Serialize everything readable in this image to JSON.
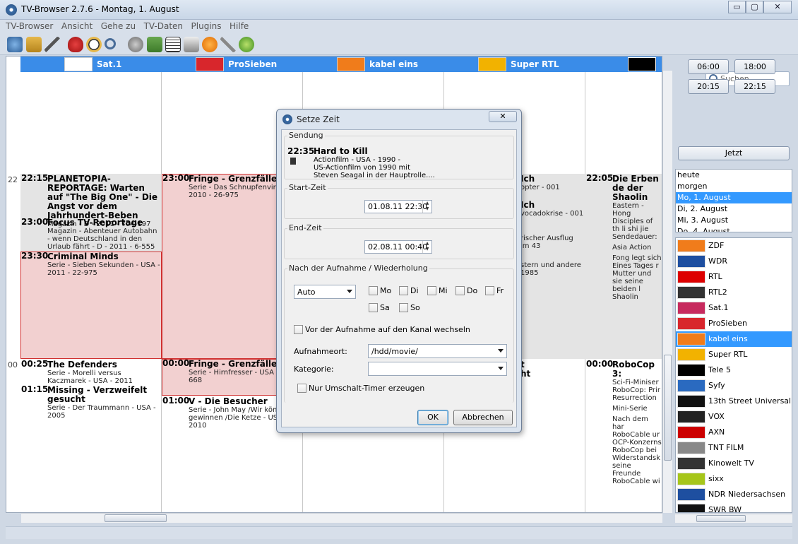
{
  "window": {
    "title": "TV-Browser 2.7.6 - Montag, 1. August",
    "min": "▭",
    "max": "▢",
    "close": "✕"
  },
  "menu": [
    "TV-Browser",
    "Ansicht",
    "Gehe zu",
    "TV-Daten",
    "Plugins",
    "Hilfe"
  ],
  "toolbar": {
    "icons": [
      "globe-update-icon",
      "tree-icon",
      "filter-icon",
      "heart-icon",
      "clock-icon",
      "search-icon",
      "film-icon",
      "copy-icon",
      "list-icon",
      "print-icon",
      "warning-icon",
      "clip-icon",
      "globe-icon"
    ],
    "search_placeholder": "Suchen..."
  },
  "channels_header": [
    {
      "name": "Sat.1",
      "color": "#c72a5e"
    },
    {
      "name": "ProSieben",
      "color": "#d8262c"
    },
    {
      "name": "kabel eins",
      "color": "#f07c1b"
    },
    {
      "name": "Super RTL",
      "color": "#f2b200"
    },
    {
      "name": "",
      "color": "#000000"
    }
  ],
  "hours": [
    "22",
    "00"
  ],
  "programs": {
    "sat1_2215": {
      "time": "22:15",
      "title": "PLANETOPIA-REPORTAGE: Warten auf \"The Big One\" - Die Angst vor dem Jahrhundert-Beben",
      "desc": "Magazin - D - 2011 - 704-197"
    },
    "sat1_2300": {
      "time": "23:00",
      "title": "Focus TV-Reportage",
      "desc": "Magazin - Abenteuer Autobahn - wenn Deutschland in den Urlaub fährt - D - 2011 - 6-555"
    },
    "sat1_2330": {
      "time": "23:30",
      "title": "Criminal Minds",
      "desc": "Serie - Sieben Sekunden - USA - 2011 - 22-975"
    },
    "sat1_0025": {
      "time": "00:25",
      "title": "The Defenders",
      "desc": "Serie - Morelli versus Kaczmarek - USA - 2011"
    },
    "sat1_0115": {
      "time": "01:15",
      "title": "Missing - Verzweifelt gesucht",
      "desc": "Serie - Der Traummann - USA - 2005"
    },
    "pro7_2300": {
      "time": "23:00",
      "title": "Fringe - Grenzfälle des",
      "desc": "Serie - Das Schnupfenvirus - 2010 - 26-975"
    },
    "pro7_0000": {
      "time": "00:00",
      "title": "Fringe - Grenzfälle des",
      "desc": "Serie - Hirnfresser - USA - 2 11-668"
    },
    "pro7_0100": {
      "time": "01:00",
      "title": "V - Die Besucher",
      "desc": "Serie - John May /Wir könn nicht gewinnen /Die Ketze - USA - 2010"
    },
    "srtl_a": {
      "title": "Ich",
      "desc": "opter - 001"
    },
    "srtl_b": {
      "title": "Ich",
      "desc": "vocadokrise - 001"
    },
    "srtl_c": {
      "desc": "rischer Ausflug im 43"
    },
    "srtl_d": {
      "desc": "stern und andere 1985"
    },
    "srtl_e": {
      "title": "t"
    },
    "srtl_f": {
      "title": "ht"
    },
    "tele5_2205": {
      "time": "22:05",
      "title": "Die Erben de der Shaolin",
      "desc": "Eastern - Hong Disciples of th li shi jie Sendedauer:",
      "extra": "Asia Action",
      "extra2": "Fong legt sich Eines Tages r Mutter und sie seine beiden l Shaolin"
    },
    "tele5_0000": {
      "time": "00:00",
      "title": "RoboCop 3:",
      "desc": "Sci-Fi-Miniser RoboCop: Prir Resurrection",
      "extra": "Mini-Serie",
      "extra2": "Nach dem har RoboCable ur OCP-Konzerns RoboCop bei Widerstandsk seine Freunde RoboCable wi"
    }
  },
  "right": {
    "times": [
      "06:00",
      "18:00",
      "20:15",
      "22:15"
    ],
    "jetzt": "Jetzt",
    "days": [
      "heute",
      "morgen",
      "Mo, 1. August",
      "Di, 2. August",
      "Mi, 3. August",
      "Do, 4. August"
    ],
    "channels": [
      "ZDF",
      "WDR",
      "RTL",
      "RTL2",
      "Sat.1",
      "ProSieben",
      "kabel eins",
      "Super RTL",
      "Tele 5",
      "Syfy",
      "13th Street Universal",
      "VOX",
      "AXN",
      "TNT FILM",
      "Kinowelt TV",
      "sixx",
      "NDR Niedersachsen",
      "SWR BW"
    ]
  },
  "dialog": {
    "title": "Setze Zeit",
    "close": "✕",
    "sendung_label": "Sendung",
    "sendung_time": "22:35",
    "sendung_title": "Hard to Kill",
    "sendung_desc1": "Actionfilm - USA - 1990 -",
    "sendung_desc2": "US-Actionfilm von 1990 mit",
    "sendung_desc3": "Steven Seagal in der Hauptrolle....",
    "start_label": "Start-Zeit",
    "start_value": "01.08.11 22:30",
    "end_label": "End-Zeit",
    "end_value": "02.08.11 00:40",
    "repeat_label": "Nach der Aufnahme / Wiederholung",
    "repeat_value": "Auto",
    "days": [
      "Mo",
      "Di",
      "Mi",
      "Do",
      "Fr",
      "Sa",
      "So"
    ],
    "switch_label": "Vor der Aufnahme auf den Kanal wechseln",
    "location_label": "Aufnahmeort:",
    "location_value": "/hdd/movie/",
    "category_label": "Kategorie:",
    "category_value": "",
    "switch_only_label": "Nur Umschalt-Timer erzeugen",
    "ok": "OK",
    "cancel": "Abbrechen"
  },
  "colors": {
    "header": "#3a8ce8",
    "selected": "#3399ff",
    "highlight": "#f2d0d0"
  }
}
